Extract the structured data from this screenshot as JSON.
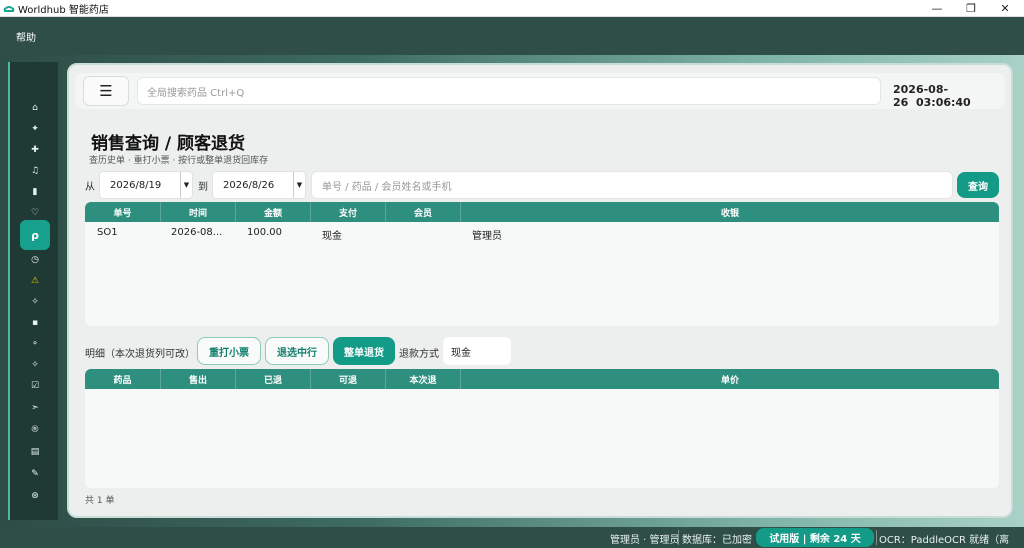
{
  "window": {
    "title": "Worldhub 智能药店",
    "minimize": "—",
    "maximize": "❐",
    "close": "✕"
  },
  "menubar": {
    "help": "帮助"
  },
  "sidebar": {
    "icons": [
      {
        "name": "home-icon",
        "glyph": "⌂"
      },
      {
        "name": "sparkle-icon",
        "glyph": "✦"
      },
      {
        "name": "plus-icon",
        "glyph": "✚"
      },
      {
        "name": "bell-icon",
        "glyph": "♫"
      },
      {
        "name": "document-icon",
        "glyph": "▮"
      },
      {
        "name": "heart-icon",
        "glyph": "♡"
      },
      {
        "name": "search-icon",
        "glyph": "ρ"
      },
      {
        "name": "clock-icon",
        "glyph": "◷"
      },
      {
        "name": "warning-icon",
        "glyph": "⚠"
      },
      {
        "name": "star-icon",
        "glyph": "✧"
      },
      {
        "name": "box-icon",
        "glyph": "▪"
      },
      {
        "name": "pin-icon",
        "glyph": "⚬"
      },
      {
        "name": "diamond-icon",
        "glyph": "✧"
      },
      {
        "name": "edit-icon",
        "glyph": "☑"
      },
      {
        "name": "send-icon",
        "glyph": "➣"
      },
      {
        "name": "info-icon",
        "glyph": "®"
      },
      {
        "name": "printer-icon",
        "glyph": "▤"
      },
      {
        "name": "pill-icon",
        "glyph": "✎"
      },
      {
        "name": "settings-icon",
        "glyph": "⊛"
      }
    ]
  },
  "header": {
    "menu_glyph": "☰",
    "search_placeholder": "全局搜索药品  Ctrl+Q",
    "date": "2026-08-26",
    "time": "03:06:40"
  },
  "page": {
    "title": "销售查询 / 顾客退货",
    "subtitle": "查历史单 · 重打小票 · 按行或整单退货回库存"
  },
  "filter": {
    "from_label": "从",
    "from_date": "2026/8/19",
    "to_label": "到",
    "to_date": "2026/8/26",
    "query_placeholder": "单号 / 药品 / 会员姓名或手机",
    "query_button": "查询",
    "arrow": "▼"
  },
  "orders_table": {
    "columns": [
      "单号",
      "时间",
      "金额",
      "支付",
      "会员",
      "收银"
    ],
    "rows": [
      [
        "SO1",
        "2026-08...",
        "100.00",
        "现金",
        "",
        "管理员"
      ]
    ]
  },
  "detail": {
    "label": "明细（本次退货列可改）",
    "reprint_button": "重打小票",
    "return_selected_button": "退选中行",
    "return_all_button": "整单退货",
    "refund_method_label": "退款方式",
    "refund_method_value": "现金"
  },
  "detail_table": {
    "columns": [
      "药品",
      "售出",
      "已退",
      "可退",
      "本次退",
      "单价"
    ]
  },
  "footer": {
    "count": "共 1 单"
  },
  "statusbar": {
    "user": "管理员 · 管理员",
    "database": "数据库：已加密",
    "trial": "试用版 | 剩余 24 天",
    "ocr": "OCR：PaddleOCR 就绪（离线）"
  }
}
